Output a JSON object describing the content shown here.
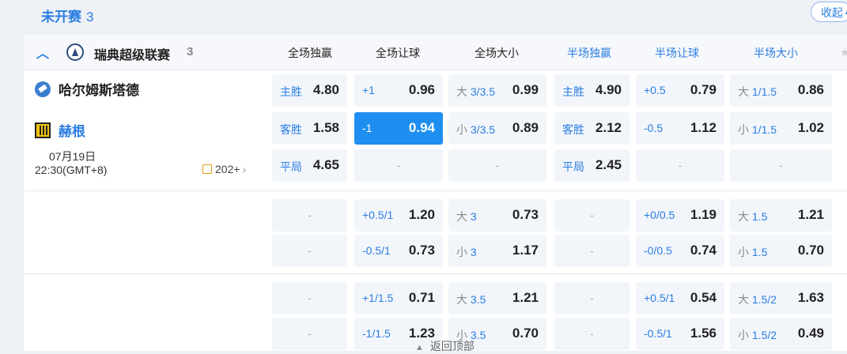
{
  "section": {
    "title": "未开赛",
    "count": "3",
    "collapse_label": "收起"
  },
  "league": {
    "name": "瑞典超级联赛",
    "count": "3"
  },
  "headers": [
    "全场独赢",
    "全场让球",
    "全场大小",
    "半场独赢",
    "半场让球",
    "半场大小"
  ],
  "match": {
    "home": "哈尔姆斯塔德",
    "away": "赫根",
    "date": "07月19日",
    "time": "22:30(GMT+8)",
    "more": "202+"
  },
  "rows": [
    [
      {
        "lbl": "主胜",
        "val": "4.80"
      },
      {
        "lbl": "+1",
        "val": "0.96"
      },
      {
        "pre": "大",
        "lbl": "3/3.5",
        "val": "0.99"
      },
      {
        "lbl": "主胜",
        "val": "4.90"
      },
      {
        "lbl": "+0.5",
        "val": "0.79"
      },
      {
        "pre": "大",
        "lbl": "1/1.5",
        "val": "0.86"
      }
    ],
    [
      {
        "lbl": "客胜",
        "val": "1.58"
      },
      {
        "lbl": "-1",
        "val": "0.94",
        "selected": true
      },
      {
        "pre": "小",
        "lbl": "3/3.5",
        "val": "0.89"
      },
      {
        "lbl": "客胜",
        "val": "2.12"
      },
      {
        "lbl": "-0.5",
        "val": "1.12"
      },
      {
        "pre": "小",
        "lbl": "1/1.5",
        "val": "1.02"
      }
    ],
    [
      {
        "lbl": "平局",
        "val": "4.65"
      },
      {
        "dash": "-"
      },
      {
        "dash": "-"
      },
      {
        "lbl": "平局",
        "val": "2.45"
      },
      {
        "dash": "-"
      },
      {
        "dash": "-"
      }
    ],
    [
      {
        "dash": "-"
      },
      {
        "lbl": "+0.5/1",
        "val": "1.20"
      },
      {
        "pre": "大",
        "lbl": "3",
        "val": "0.73"
      },
      {
        "dash": "-"
      },
      {
        "lbl": "+0/0.5",
        "val": "1.19"
      },
      {
        "pre": "大",
        "lbl": "1.5",
        "val": "1.21"
      }
    ],
    [
      {
        "dash": "-"
      },
      {
        "lbl": "-0.5/1",
        "val": "0.73"
      },
      {
        "pre": "小",
        "lbl": "3",
        "val": "1.17"
      },
      {
        "dash": "-"
      },
      {
        "lbl": "-0/0.5",
        "val": "0.74"
      },
      {
        "pre": "小",
        "lbl": "1.5",
        "val": "0.70"
      }
    ],
    [
      {
        "dash": "-"
      },
      {
        "lbl": "+1/1.5",
        "val": "0.71"
      },
      {
        "pre": "大",
        "lbl": "3.5",
        "val": "1.21"
      },
      {
        "dash": "-"
      },
      {
        "lbl": "+0.5/1",
        "val": "0.54"
      },
      {
        "pre": "大",
        "lbl": "1.5/2",
        "val": "1.63"
      }
    ],
    [
      {
        "dash": "-"
      },
      {
        "lbl": "-1/1.5",
        "val": "1.23"
      },
      {
        "pre": "小",
        "lbl": "3.5",
        "val": "0.70"
      },
      {
        "dash": "-"
      },
      {
        "lbl": "-0.5/1",
        "val": "1.56"
      },
      {
        "pre": "小",
        "lbl": "1.5/2",
        "val": "0.49"
      }
    ]
  ],
  "back_to_top": "返回顶部"
}
